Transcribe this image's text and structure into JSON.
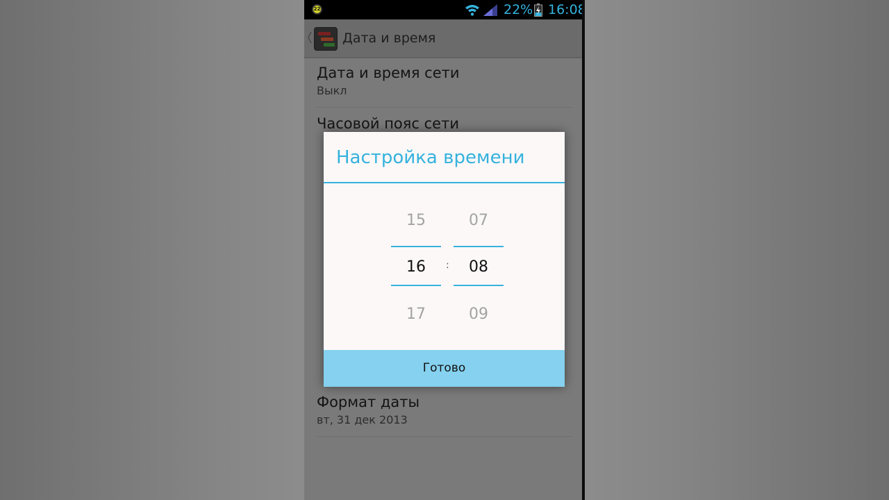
{
  "status_bar": {
    "notification_badge": "22",
    "battery_percent": "22%",
    "clock": "16:08",
    "accent_color": "#35b2dd",
    "icons": [
      "notification-icon",
      "wifi-icon",
      "cell-signal-icon",
      "battery-icon"
    ]
  },
  "action_bar": {
    "title": "Дата и время",
    "icons": [
      "back-chevron-icon",
      "settings-app-icon"
    ]
  },
  "settings": {
    "network_datetime": {
      "title": "Дата и время сети",
      "summary": "Выкл"
    },
    "network_timezone": {
      "title": "Часовой пояс сети"
    },
    "date_format": {
      "title": "Формат даты",
      "summary": "вт, 31 дек 2013"
    }
  },
  "dialog": {
    "title": "Настройка времени",
    "separator": ":",
    "hours": {
      "previous": "15",
      "current": "16",
      "next": "17"
    },
    "minutes": {
      "previous": "07",
      "current": "08",
      "next": "09"
    },
    "done_label": "Готово",
    "accent_color": "#35b2dd",
    "button_color": "#85d1ef"
  }
}
